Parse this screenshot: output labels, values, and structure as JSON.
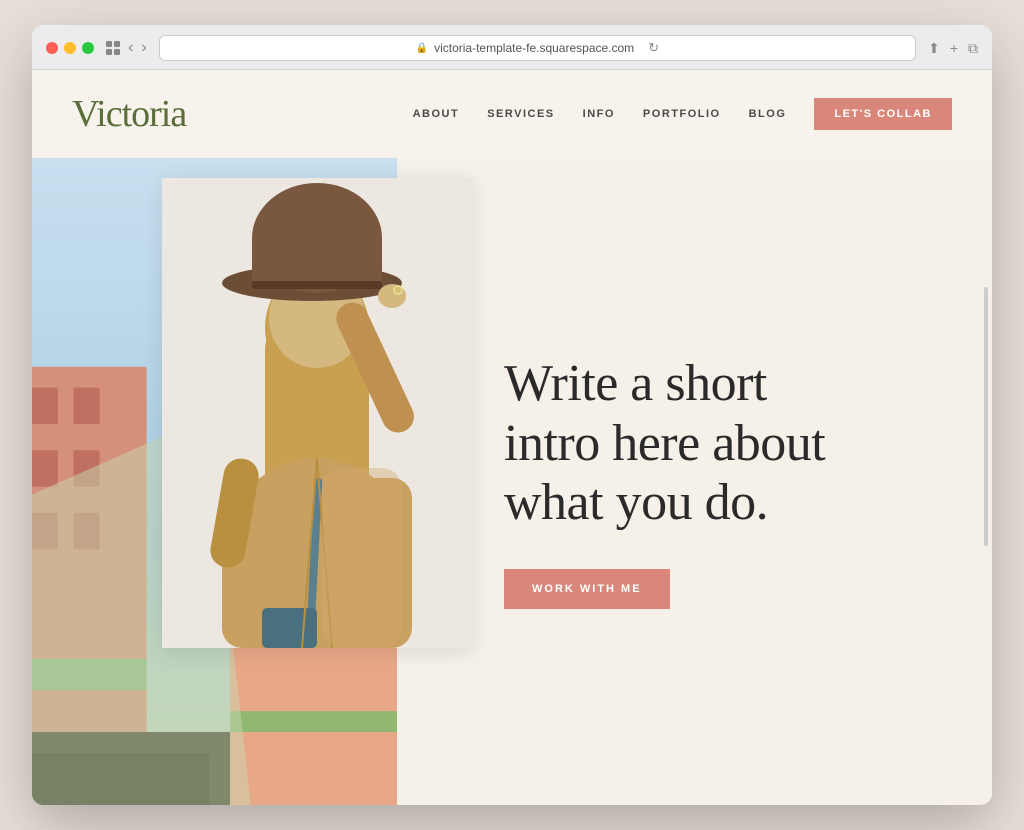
{
  "browser": {
    "url": "victoria-template-fe.squarespace.com",
    "reload_icon": "↻"
  },
  "site": {
    "logo": "Victoria",
    "nav": {
      "links": [
        "ABOUT",
        "SERVICES",
        "INFO",
        "PORTFOLIO",
        "BLOG"
      ],
      "cta": "LET'S COLLAB"
    },
    "hero": {
      "heading_line1": "Write a short",
      "heading_line2": "intro here about",
      "heading_line3": "what you do.",
      "cta_button": "WORK WITH ME"
    }
  }
}
